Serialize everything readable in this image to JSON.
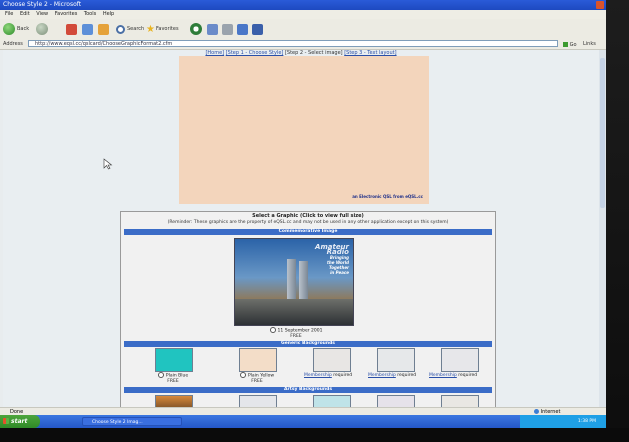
{
  "window": {
    "title": "Choose Style 2 - Microsoft"
  },
  "menu": [
    "File",
    "Edit",
    "View",
    "Favorites",
    "Tools",
    "Help"
  ],
  "toolbar": {
    "back_label": "Back",
    "search_label": "Search",
    "favorites_label": "Favorites"
  },
  "address": {
    "label": "Address",
    "url": "http://www.eqsl.cc/qslcard/ChooseGraphicFormat2.cfm",
    "go_label": "Go",
    "links_label": "Links"
  },
  "breadcrumb": {
    "home": "[Home]",
    "step1": "[Step 1 - Choose Style]",
    "step2": "[Step 2 - Select image]",
    "step3": "[Step 3 - Text layout]"
  },
  "preview": {
    "credit": "an Electronic QSL from eQSL.cc"
  },
  "panel": {
    "title": "Select a Graphic (Click to view full size)",
    "reminder": "(Reminder: These graphics are the property of eQSL.cc and may not be used in any other application except on this system)",
    "sections": [
      "Commemorative Image",
      "Generic Backgrounds",
      "Artsy Backgrounds"
    ],
    "featured": {
      "line1": "Amateur",
      "line2": "Radio",
      "line3": "Bringing",
      "line4": "the World",
      "line5": "Together",
      "line6": "in Peace",
      "option_label": "11 September 2001",
      "price": "FREE"
    },
    "generic": [
      {
        "label": "Plain Blue",
        "price": "FREE",
        "color": "#20c4c0"
      },
      {
        "label": "Plain Yellow",
        "price": "FREE",
        "color": "#f3ddc8"
      },
      {
        "link": "Membership",
        "text": "required",
        "color": "#e8e6e4"
      },
      {
        "link": "Membership",
        "text": "required",
        "color": "#e6e8ea"
      },
      {
        "link": "Membership",
        "text": "required",
        "color": "#e7e7ea"
      }
    ]
  },
  "status": {
    "left": "Done",
    "zone": "Internet"
  },
  "taskbar": {
    "start": "start",
    "item": "Choose Style 2 Imag...",
    "clock": "1:38 PM"
  },
  "colors": {
    "accent": "#3b6cc7",
    "preview": "#f3d5bc",
    "link": "#2a4fa8"
  }
}
